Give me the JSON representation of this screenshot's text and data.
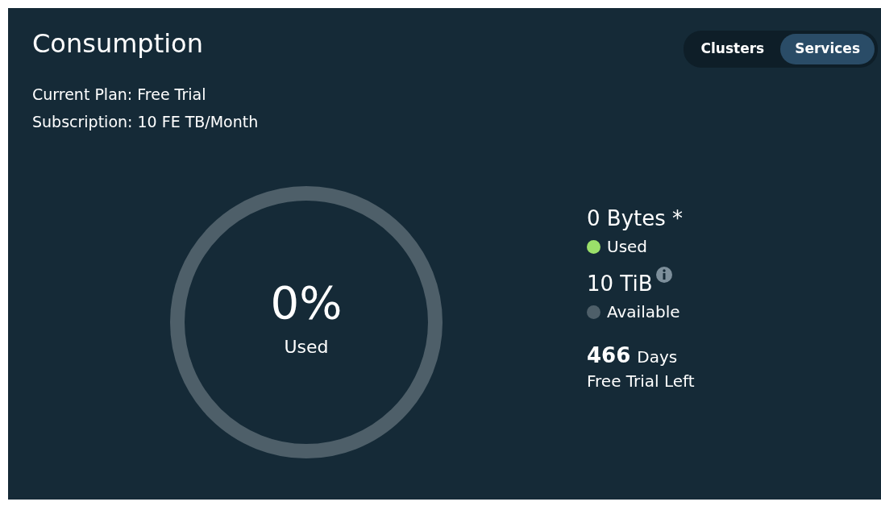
{
  "title": "Consumption",
  "toggle": [
    {
      "label": "Clusters",
      "selected": false
    },
    {
      "label": "Services",
      "selected": true
    }
  ],
  "plan": "Current Plan: Free Trial",
  "subscription": "Subscription: 10 FE TB/Month",
  "gauge": {
    "level": 0,
    "percent": "0%",
    "label": "Used"
  },
  "legend": [
    {
      "value": "0 Bytes *",
      "label": "Used",
      "color": "#9be06a",
      "info": false
    },
    {
      "value": "10 TiB",
      "label": "Available",
      "color": "#4e5f69",
      "info": true
    }
  ],
  "trial": {
    "number": "466",
    "unit": "Days",
    "label": "Free Trial Left"
  }
}
